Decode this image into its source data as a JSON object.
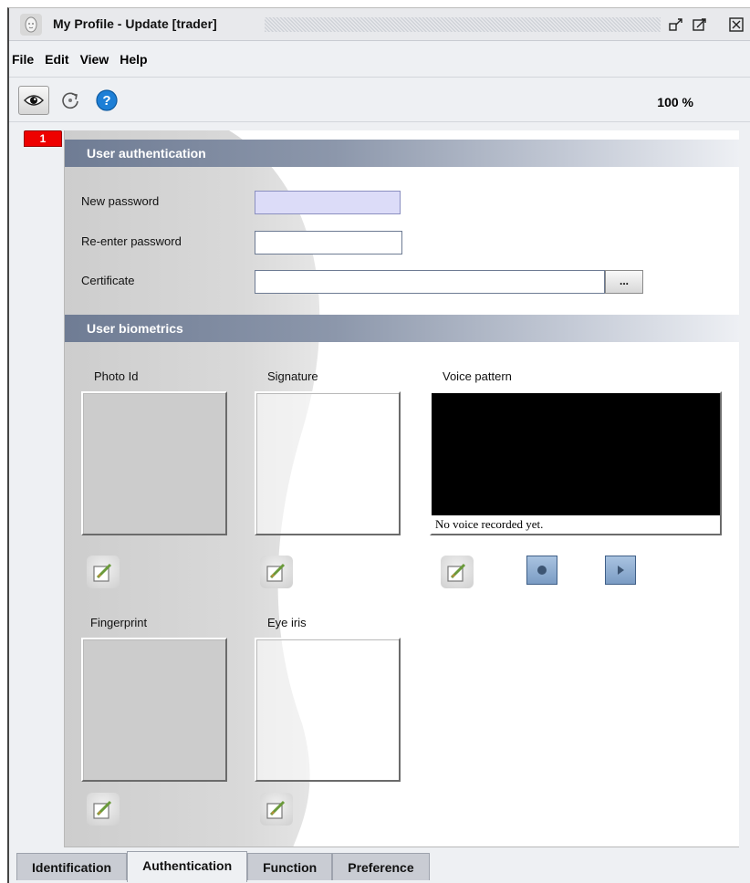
{
  "window": {
    "title": "My Profile - Update [trader]",
    "icons": {
      "app": "face-logo-icon",
      "detach": "detach-icon",
      "maximize": "maximize-icon",
      "close": "close-icon"
    }
  },
  "menu": {
    "items": [
      "File",
      "Edit",
      "View",
      "Help"
    ]
  },
  "toolbar": {
    "buttons": [
      "eye-icon",
      "refresh-icon",
      "help-icon"
    ],
    "zoom": "100 %"
  },
  "page_indicator": "1",
  "authentication": {
    "header": "User authentication",
    "new_password_label": "New password",
    "new_password_value": "",
    "reenter_password_label": "Re-enter password",
    "reenter_password_value": "",
    "certificate_label": "Certificate",
    "certificate_value": "",
    "browse_label": "..."
  },
  "biometrics": {
    "header": "User biometrics",
    "photo_label": "Photo Id",
    "signature_label": "Signature",
    "voice_label": "Voice pattern",
    "voice_status": "No voice recorded yet.",
    "fingerprint_label": "Fingerprint",
    "iris_label": "Eye iris",
    "icons": {
      "edit": "edit-icon",
      "record": "record-icon",
      "play": "play-icon"
    }
  },
  "tabs": [
    "Identification",
    "Authentication",
    "Function",
    "Preference"
  ],
  "active_tab": "Authentication",
  "colors": {
    "header_gradient_start": "#6f7c94",
    "focused_input": "#dcdcf8",
    "page_indicator": "#ee0000",
    "voice_box": "#000000"
  }
}
